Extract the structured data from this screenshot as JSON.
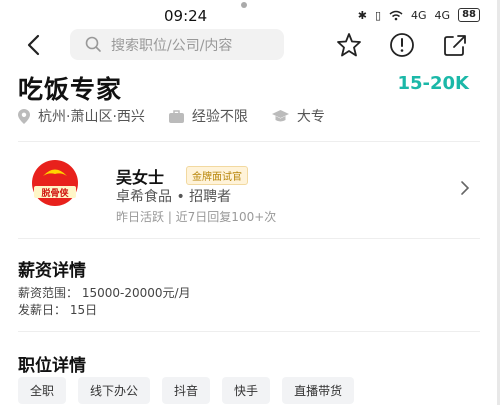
{
  "status_bar": {
    "time": "09:24",
    "signal_labels": [
      "4G",
      "4G"
    ],
    "battery": "88"
  },
  "nav": {
    "search_placeholder": "搜索职位/公司/内容"
  },
  "job": {
    "title": "吃饭专家",
    "salary": "15-20K",
    "location": "杭州·萧山区·西兴",
    "experience": "经验不限",
    "education": "大专"
  },
  "recruiter": {
    "avatar_text": "脱骨侠",
    "name": "吴女士",
    "badge": "金牌面试官",
    "company": "卓希食品 • 招聘者",
    "activity": "昨日活跃 | 近7日回复100+次"
  },
  "salary_details": {
    "heading": "薪资详情",
    "range": "薪资范围： 15000-20000元/月",
    "payday": "发薪日： 15日"
  },
  "job_details": {
    "heading": "职位详情",
    "chips": [
      "全职",
      "线下办公",
      "抖音",
      "快手",
      "直播带货"
    ]
  },
  "colors": {
    "accent": "#1bb8a8",
    "badge_text": "#b8860b"
  }
}
